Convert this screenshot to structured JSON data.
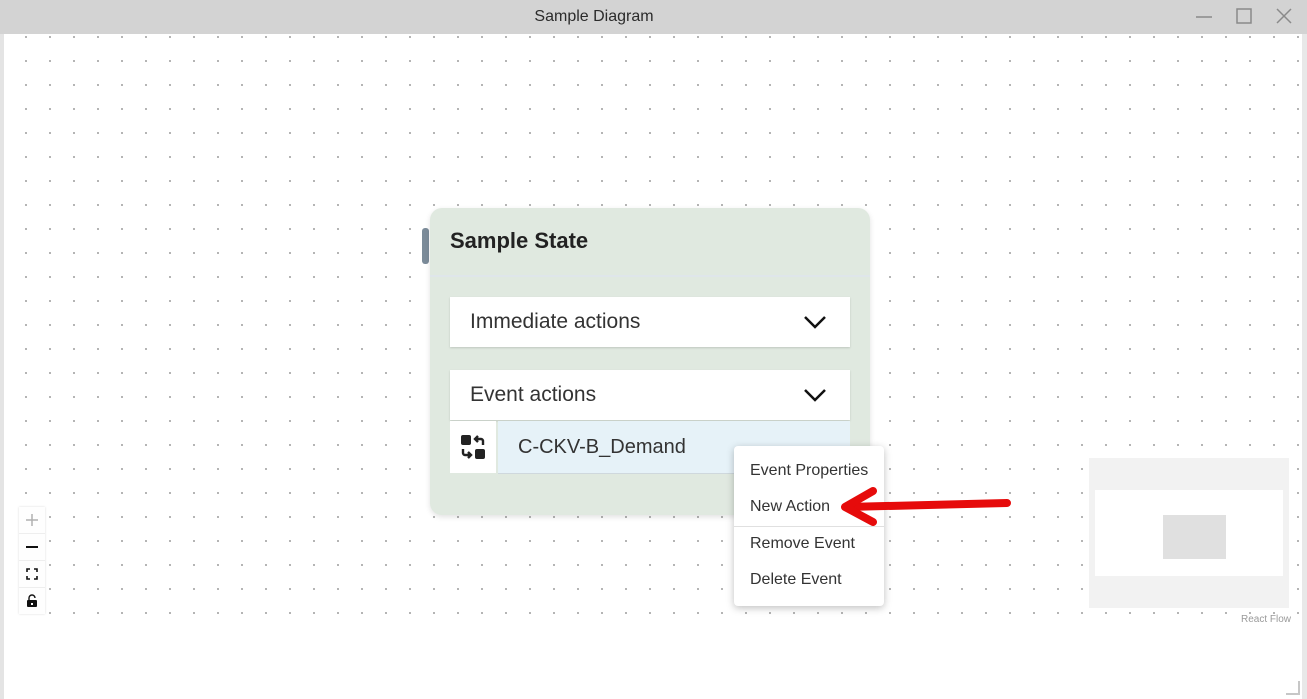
{
  "window": {
    "title": "Sample Diagram",
    "controls": {
      "minimize_icon": "minimize-icon",
      "maximize_icon": "maximize-icon",
      "close_icon": "close-icon"
    }
  },
  "node": {
    "title": "Sample State",
    "sections": [
      {
        "label": "Immediate actions",
        "icon": "chevron-down-icon"
      },
      {
        "label": "Event actions",
        "icon": "chevron-down-icon"
      }
    ],
    "events": [
      {
        "name": "C-CKV-B_Demand",
        "icon": "swap-icon"
      }
    ]
  },
  "context_menu": {
    "items": [
      {
        "label": "Event Properties"
      },
      {
        "label": "New Action",
        "highlighted_by_annotation": true
      },
      {
        "label": "Remove Event"
      },
      {
        "label": "Delete Event"
      }
    ]
  },
  "flow_controls": [
    {
      "name": "zoom-in",
      "icon": "plus-icon"
    },
    {
      "name": "zoom-out",
      "icon": "minus-icon"
    },
    {
      "name": "fit-view",
      "icon": "fit-view-icon"
    },
    {
      "name": "interactivity-lock",
      "icon": "lock-icon"
    }
  ],
  "attribution": "React Flow",
  "annotation": {
    "type": "arrow",
    "color": "#e60b0b",
    "points_to": "New Action"
  }
}
